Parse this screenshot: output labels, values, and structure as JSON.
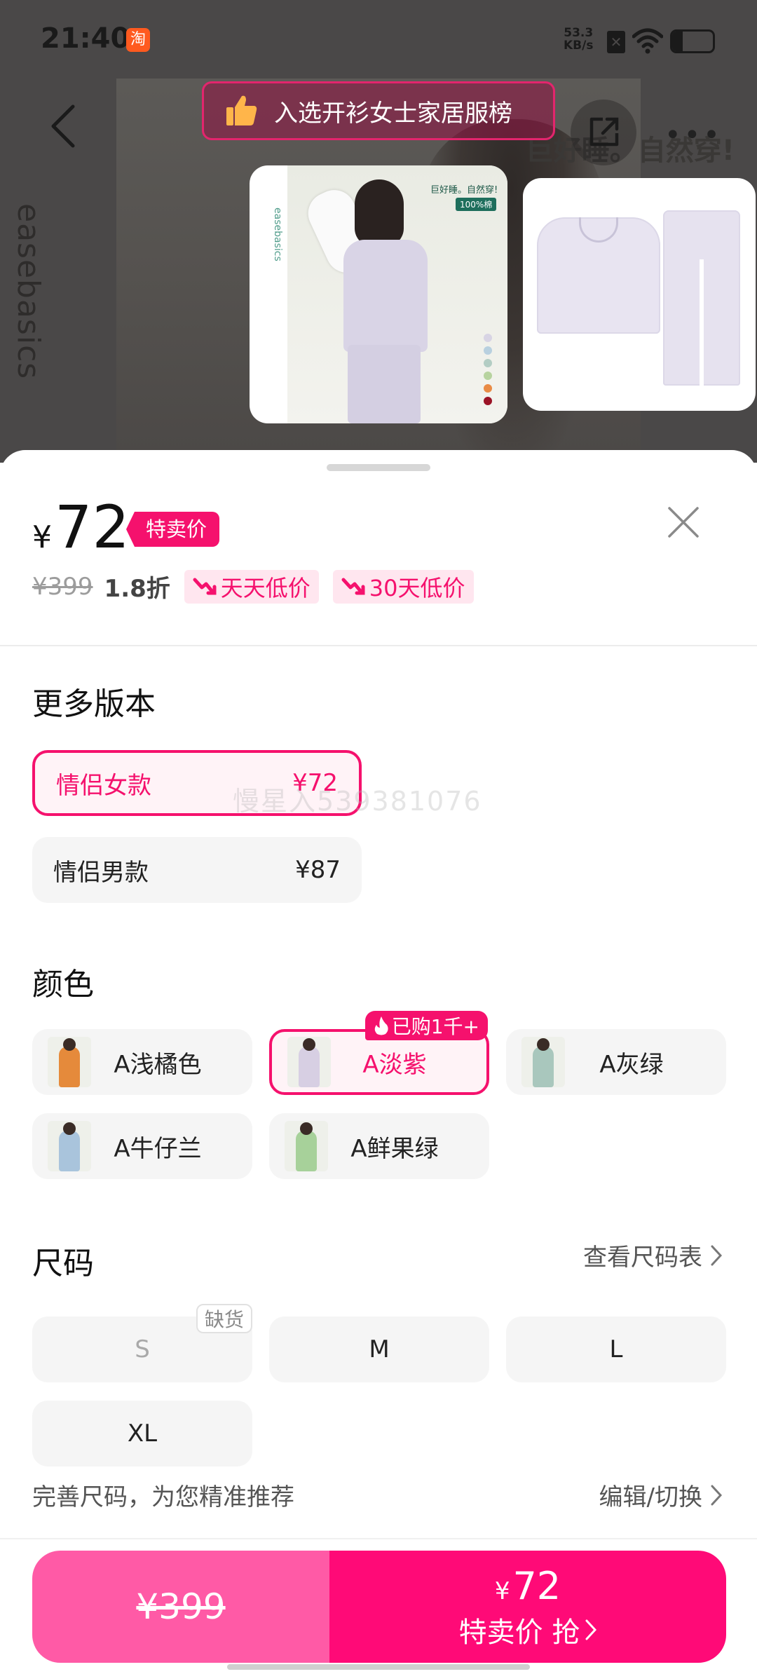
{
  "status_bar": {
    "time": "21:40",
    "app_badge": "淘",
    "net_speed_value": "53.3",
    "net_speed_unit": "KB/s",
    "battery_level": 0.25
  },
  "background": {
    "brand": "easebasics",
    "slogan": "巨好睡。自然穿!"
  },
  "ranking_banner": {
    "text": "入选开衫女士家居服榜"
  },
  "thumbnails": {
    "first": {
      "brand": "easebasics",
      "slogan": "巨好睡。自然穿!",
      "tag": "100%棉"
    }
  },
  "price": {
    "symbol": "¥",
    "value": "72",
    "label": "特卖价",
    "original": "¥399",
    "discount": "1.8折",
    "tags": [
      "天天低价",
      "30天低价"
    ]
  },
  "versions": {
    "title": "更多版本",
    "items": [
      {
        "name": "情侣女款",
        "price": "¥72",
        "selected": true
      },
      {
        "name": "情侣男款",
        "price": "¥87",
        "selected": false
      }
    ]
  },
  "colors": {
    "title": "颜色",
    "hot_badge": "已购1千+",
    "items": [
      {
        "name": "A浅橘色",
        "swatch": "#e58a3b",
        "selected": false
      },
      {
        "name": "A淡紫",
        "swatch": "#d7cfe3",
        "selected": true
      },
      {
        "name": "A灰绿",
        "swatch": "#a9c7bd",
        "selected": false
      },
      {
        "name": "A牛仔兰",
        "swatch": "#a9c4dc",
        "selected": false
      },
      {
        "name": "A鲜果绿",
        "swatch": "#a7d19a",
        "selected": false
      }
    ]
  },
  "sizes": {
    "title": "尺码",
    "chart_link": "查看尺码表",
    "out_of_stock": "缺货",
    "items": [
      {
        "name": "S",
        "available": false
      },
      {
        "name": "M",
        "available": true
      },
      {
        "name": "L",
        "available": true
      },
      {
        "name": "XL",
        "available": true
      }
    ],
    "recommend": "完善尺码，为您精准推荐",
    "edit_link": "编辑/切换"
  },
  "watermark": "慢星入539381076",
  "buy_bar": {
    "original_price": "¥399",
    "price_symbol": "¥",
    "price_value": "72",
    "action_label": "特卖价 抢"
  },
  "colors_theme": {
    "accent": "#f5116d",
    "buy_left": "#ff5aa6",
    "buy_right": "#ff0a77"
  }
}
